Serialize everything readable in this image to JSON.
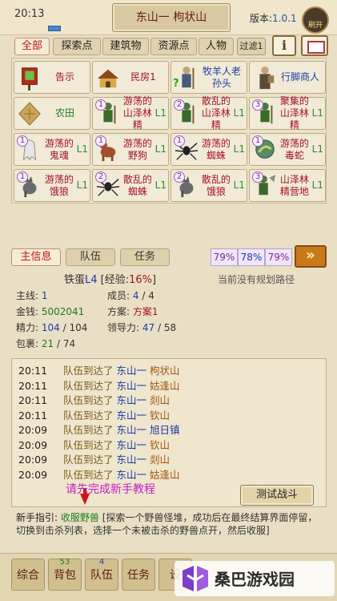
{
  "top": {
    "time": "20:13",
    "location": "东山一  枸状山",
    "version_prefix": "版本:",
    "version": "1.0.1",
    "avatar_label": "刷开"
  },
  "filters": {
    "tabs": [
      "全部",
      "探索点",
      "建筑物",
      "资源点",
      "人物"
    ],
    "filter_btn": "过滤1",
    "info_btn": "i"
  },
  "grid": [
    {
      "label": "告示",
      "style": "red",
      "badge": "",
      "icon": "notice-icon"
    },
    {
      "label": "民房1",
      "style": "red",
      "badge": "",
      "icon": "house-icon"
    },
    {
      "label": "牧羊人老孙头",
      "style": "blue",
      "badge": "",
      "icon": "shepherd-icon",
      "quest": "?"
    },
    {
      "label": "行脚商人",
      "style": "blue",
      "badge": "",
      "icon": "merchant-icon"
    },
    {
      "label": "农田",
      "style": "green",
      "badge": "",
      "icon": "farmland-icon"
    },
    {
      "label": "游荡的山泽林精",
      "lv": "L1",
      "style": "red",
      "badge": "1",
      "icon": "forest-spirit-icon"
    },
    {
      "label": "散乱的山泽林精",
      "lv": "L1",
      "style": "red",
      "badge": "2",
      "icon": "forest-spirit-icon"
    },
    {
      "label": "聚集的山泽林精",
      "lv": "L1",
      "style": "red",
      "badge": "3",
      "icon": "forest-spirit-icon"
    },
    {
      "label": "游荡的鬼魂",
      "lv": "L1",
      "style": "red",
      "badge": "1",
      "icon": "ghost-icon"
    },
    {
      "label": "游荡的野狗",
      "lv": "L1",
      "style": "red",
      "badge": "1",
      "icon": "dog-icon"
    },
    {
      "label": "游荡的蜘蛛",
      "lv": "L1",
      "style": "red",
      "badge": "1",
      "icon": "spider-icon"
    },
    {
      "label": "游荡的毒蛇",
      "lv": "L1",
      "style": "red",
      "badge": "1",
      "icon": "snake-icon"
    },
    {
      "label": "游荡的饿狼",
      "lv": "L1",
      "style": "red",
      "badge": "1",
      "icon": "wolf-icon"
    },
    {
      "label": "散乱的蜘蛛",
      "lv": "L1",
      "style": "red",
      "badge": "2",
      "icon": "spider-icon"
    },
    {
      "label": "散乱的饿狼",
      "lv": "L1",
      "style": "red",
      "badge": "2",
      "icon": "wolf-icon"
    },
    {
      "label": "山泽林精营地",
      "lv": "L1",
      "style": "red",
      "badge": "3",
      "icon": "forest-camp-icon"
    }
  ],
  "info_tabs": {
    "main": "主信息",
    "team": "队伍",
    "task": "任务"
  },
  "percents": [
    "79%",
    "78%",
    "79%"
  ],
  "stats": {
    "name": "铁蛋",
    "level": "L4",
    "exp_label": "[经验:",
    "exp": "16%",
    "exp_end": "]",
    "route": "当前没有规划路径",
    "mainline_label": "主线:",
    "mainline": "1",
    "money_label": "金钱:",
    "money": "5002041",
    "energy_label": "精力:",
    "energy": "104",
    "energy_max": "/ 104",
    "bag_label": "包裹:",
    "bag": "21",
    "bag_max": "/ 74",
    "members_label": "成员:",
    "members": "4",
    "members_max": "/ 4",
    "plan_label": "方案:",
    "plan": "方案1",
    "lead_label": "领导力:",
    "lead": "47",
    "lead_max": "/ 58"
  },
  "log": [
    {
      "t": "20:11",
      "m": "队伍到达了",
      "p1": "东山一",
      "p2": "枸状山"
    },
    {
      "t": "20:11",
      "m": "队伍到达了",
      "p1": "东山一",
      "p2": "姑逢山"
    },
    {
      "t": "20:11",
      "m": "队伍到达了",
      "p1": "东山一",
      "p2": "剡山"
    },
    {
      "t": "20:11",
      "m": "队伍到达了",
      "p1": "东山一",
      "p2": "钦山"
    },
    {
      "t": "20:09",
      "m": "队伍到达了",
      "p1": "东山一",
      "p2": "旭日镇",
      "p2blue": true
    },
    {
      "t": "20:09",
      "m": "队伍到达了",
      "p1": "东山一",
      "p2": "钦山"
    },
    {
      "t": "20:09",
      "m": "队伍到达了",
      "p1": "东山一",
      "p2": "剡山"
    },
    {
      "t": "20:09",
      "m": "队伍到达了",
      "p1": "东山一",
      "p2": "姑逢山"
    }
  ],
  "hint": "请先完成新手教程",
  "battle_btn": "测试战斗",
  "guide": {
    "label": "新手指引:",
    "title": "收服野兽",
    "text": "[探索一个野兽怪堆，成功后在最终结算界面停留，切换到击杀列表，选择一个未被击杀的野兽点开，然后收服]"
  },
  "bottom": {
    "tabs": [
      "综合",
      "背包",
      "队伍",
      "任务",
      "设"
    ],
    "counts": [
      "",
      "53",
      "4",
      "",
      ""
    ]
  },
  "watermark": "桑巴游戏园",
  "colors": {
    "accent_red": "#c0161a",
    "blue": "#1b3aa8",
    "green": "#1f7a1f",
    "purple": "#7a2a9a"
  }
}
